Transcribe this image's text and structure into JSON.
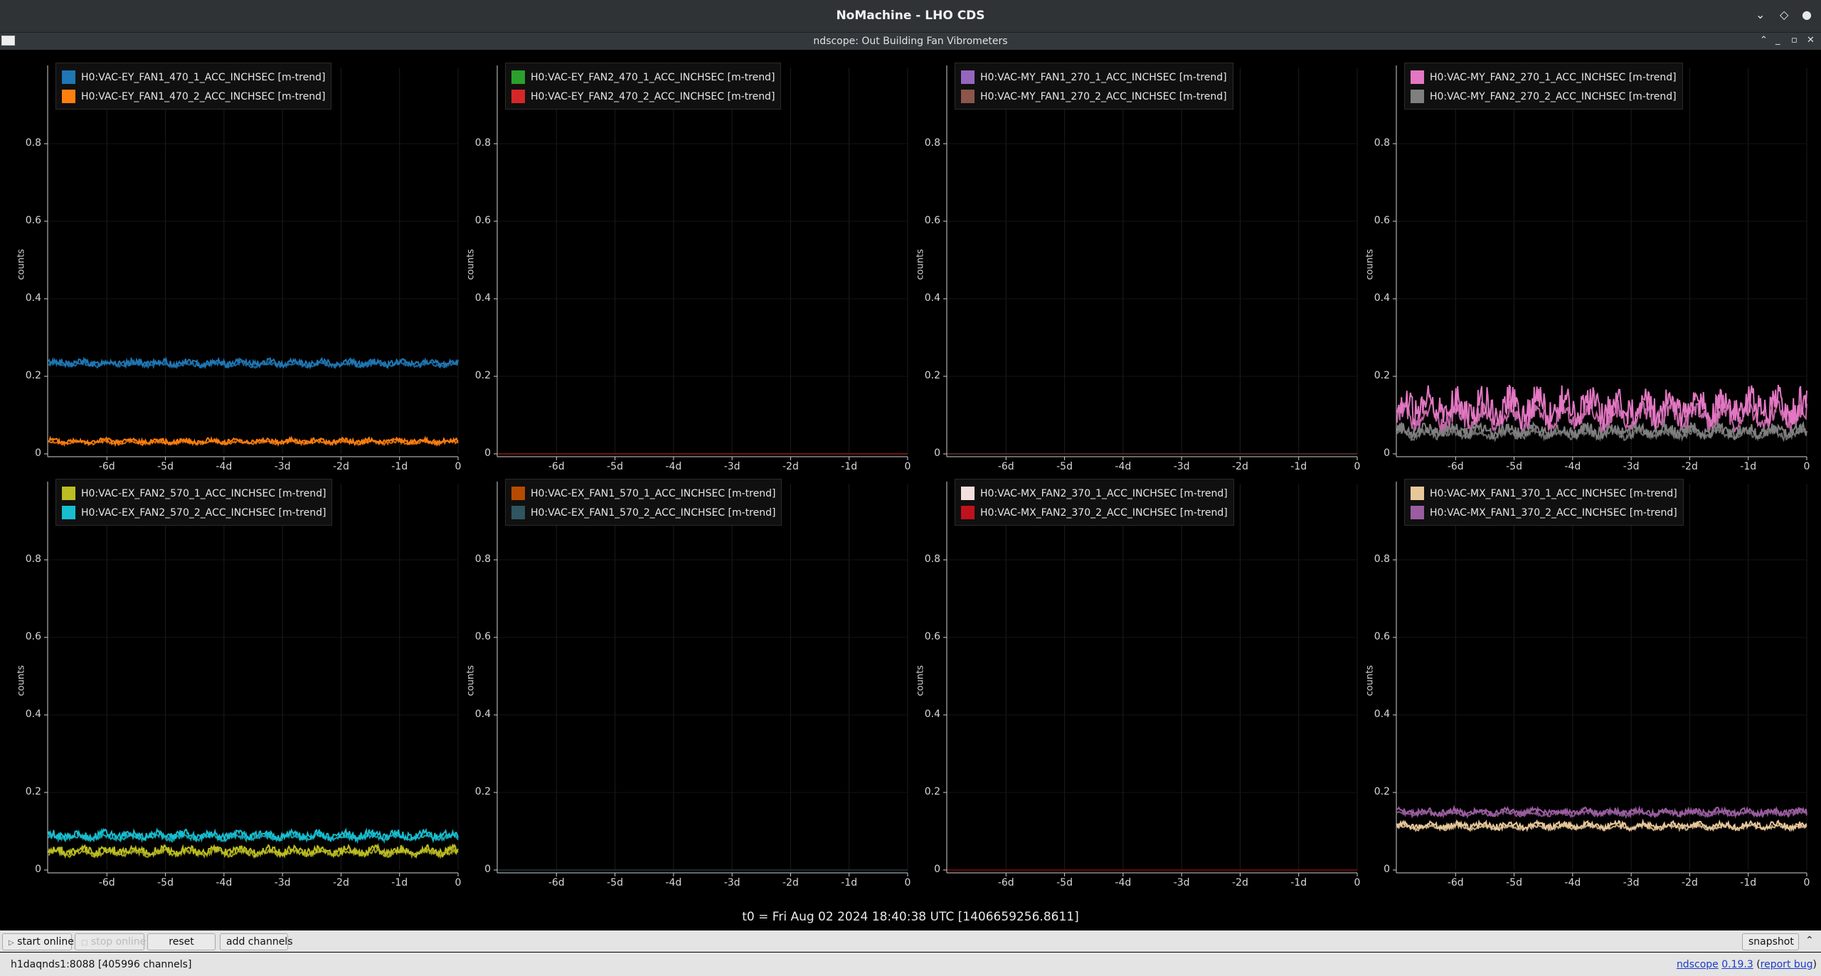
{
  "window": {
    "title": "NoMachine - LHO CDS",
    "app_title": "ndscope: Out Building Fan Vibrometers"
  },
  "axis": {
    "ylabel": "counts",
    "y_ticks": [
      "0",
      "0.2",
      "0.4",
      "0.6",
      "0.8"
    ],
    "x_ticks": [
      "-6d",
      "-5d",
      "-4d",
      "-3d",
      "-2d",
      "-1d",
      "0"
    ]
  },
  "plots": [
    {
      "legend": [
        {
          "name": "H0:VAC-EY_FAN1_470_1_ACC_INCHSEC [m-trend]",
          "color": "#1f77b4"
        },
        {
          "name": "H0:VAC-EY_FAN1_470_2_ACC_INCHSEC [m-trend]",
          "color": "#ff7f0e"
        }
      ]
    },
    {
      "legend": [
        {
          "name": "H0:VAC-EY_FAN2_470_1_ACC_INCHSEC [m-trend]",
          "color": "#2ca02c"
        },
        {
          "name": "H0:VAC-EY_FAN2_470_2_ACC_INCHSEC [m-trend]",
          "color": "#d62728"
        }
      ]
    },
    {
      "legend": [
        {
          "name": "H0:VAC-MY_FAN1_270_1_ACC_INCHSEC [m-trend]",
          "color": "#9467bd"
        },
        {
          "name": "H0:VAC-MY_FAN1_270_2_ACC_INCHSEC [m-trend]",
          "color": "#8c564b"
        }
      ]
    },
    {
      "legend": [
        {
          "name": "H0:VAC-MY_FAN2_270_1_ACC_INCHSEC [m-trend]",
          "color": "#e377c2"
        },
        {
          "name": "H0:VAC-MY_FAN2_270_2_ACC_INCHSEC [m-trend]",
          "color": "#7f7f7f"
        }
      ]
    },
    {
      "legend": [
        {
          "name": "H0:VAC-EX_FAN2_570_1_ACC_INCHSEC [m-trend]",
          "color": "#bcbd22"
        },
        {
          "name": "H0:VAC-EX_FAN2_570_2_ACC_INCHSEC [m-trend]",
          "color": "#17becf"
        }
      ]
    },
    {
      "legend": [
        {
          "name": "H0:VAC-EX_FAN1_570_1_ACC_INCHSEC [m-trend]",
          "color": "#b84a00"
        },
        {
          "name": "H0:VAC-EX_FAN1_570_2_ACC_INCHSEC [m-trend]",
          "color": "#2f5560"
        }
      ]
    },
    {
      "legend": [
        {
          "name": "H0:VAC-MX_FAN2_370_1_ACC_INCHSEC [m-trend]",
          "color": "#f4dede"
        },
        {
          "name": "H0:VAC-MX_FAN2_370_2_ACC_INCHSEC [m-trend]",
          "color": "#c0121c"
        }
      ]
    },
    {
      "legend": [
        {
          "name": "H0:VAC-MX_FAN1_370_1_ACC_INCHSEC [m-trend]",
          "color": "#e8c89a"
        },
        {
          "name": "H0:VAC-MX_FAN1_370_2_ACC_INCHSEC [m-trend]",
          "color": "#9a5ea0"
        }
      ]
    }
  ],
  "chart_data": [
    {
      "type": "line",
      "xlabel": "",
      "ylabel": "counts",
      "xlim": [
        -7,
        0
      ],
      "ylim": [
        0,
        1
      ],
      "series": [
        {
          "name": "H0:VAC-EY_FAN1_470_1_ACC_INCHSEC [m-trend]",
          "level": 0.235
        },
        {
          "name": "H0:VAC-EY_FAN1_470_2_ACC_INCHSEC [m-trend]",
          "level": 0.033
        }
      ]
    },
    {
      "type": "line",
      "xlabel": "",
      "ylabel": "counts",
      "xlim": [
        -7,
        0
      ],
      "ylim": [
        0,
        1
      ],
      "series": [
        {
          "name": "H0:VAC-EY_FAN2_470_1_ACC_INCHSEC [m-trend]",
          "level": 0.0
        },
        {
          "name": "H0:VAC-EY_FAN2_470_2_ACC_INCHSEC [m-trend]",
          "level": 0.0
        }
      ]
    },
    {
      "type": "line",
      "xlabel": "",
      "ylabel": "counts",
      "xlim": [
        -7,
        0
      ],
      "ylim": [
        0,
        1
      ],
      "series": [
        {
          "name": "H0:VAC-MY_FAN1_270_1_ACC_INCHSEC [m-trend]",
          "level": 0.0
        },
        {
          "name": "H0:VAC-MY_FAN1_270_2_ACC_INCHSEC [m-trend]",
          "level": 0.0
        }
      ]
    },
    {
      "type": "line",
      "xlabel": "",
      "ylabel": "counts",
      "xlim": [
        -7,
        0
      ],
      "ylim": [
        0,
        1
      ],
      "series": [
        {
          "name": "H0:VAC-MY_FAN2_270_1_ACC_INCHSEC [m-trend]",
          "level": 0.12
        },
        {
          "name": "H0:VAC-MY_FAN2_270_2_ACC_INCHSEC [m-trend]",
          "level": 0.06
        }
      ]
    },
    {
      "type": "line",
      "xlabel": "",
      "ylabel": "counts",
      "xlim": [
        -7,
        0
      ],
      "ylim": [
        0,
        1
      ],
      "series": [
        {
          "name": "H0:VAC-EX_FAN2_570_1_ACC_INCHSEC [m-trend]",
          "level": 0.05
        },
        {
          "name": "H0:VAC-EX_FAN2_570_2_ACC_INCHSEC [m-trend]",
          "level": 0.09
        }
      ]
    },
    {
      "type": "line",
      "xlabel": "",
      "ylabel": "counts",
      "xlim": [
        -7,
        0
      ],
      "ylim": [
        0,
        1
      ],
      "series": [
        {
          "name": "H0:VAC-EX_FAN1_570_1_ACC_INCHSEC [m-trend]",
          "level": 0.0
        },
        {
          "name": "H0:VAC-EX_FAN1_570_2_ACC_INCHSEC [m-trend]",
          "level": 0.0
        }
      ]
    },
    {
      "type": "line",
      "xlabel": "",
      "ylabel": "counts",
      "xlim": [
        -7,
        0
      ],
      "ylim": [
        0,
        1
      ],
      "series": [
        {
          "name": "H0:VAC-MX_FAN2_370_1_ACC_INCHSEC [m-trend]",
          "level": 0.0
        },
        {
          "name": "H0:VAC-MX_FAN2_370_2_ACC_INCHSEC [m-trend]",
          "level": 0.0
        }
      ]
    },
    {
      "type": "line",
      "xlabel": "",
      "ylabel": "counts",
      "xlim": [
        -7,
        0
      ],
      "ylim": [
        0,
        1
      ],
      "series": [
        {
          "name": "H0:VAC-MX_FAN1_370_1_ACC_INCHSEC [m-trend]",
          "level": 0.115
        },
        {
          "name": "H0:VAC-MX_FAN1_370_2_ACC_INCHSEC [m-trend]",
          "level": 0.15
        }
      ]
    }
  ],
  "t0_text": "t0 = Fri Aug 02 2024 18:40:38 UTC [1406659256.8611]",
  "toolbar": {
    "start_online": "start online",
    "stop_online": "stop online",
    "reset": "reset",
    "add_channels": "add channels",
    "snapshot": "snapshot"
  },
  "status": {
    "server": "h1daqnds1:8088",
    "channels": "[405996 channels]",
    "app_name": "ndscope",
    "version": "0.19.3",
    "report_bug": "report bug"
  }
}
